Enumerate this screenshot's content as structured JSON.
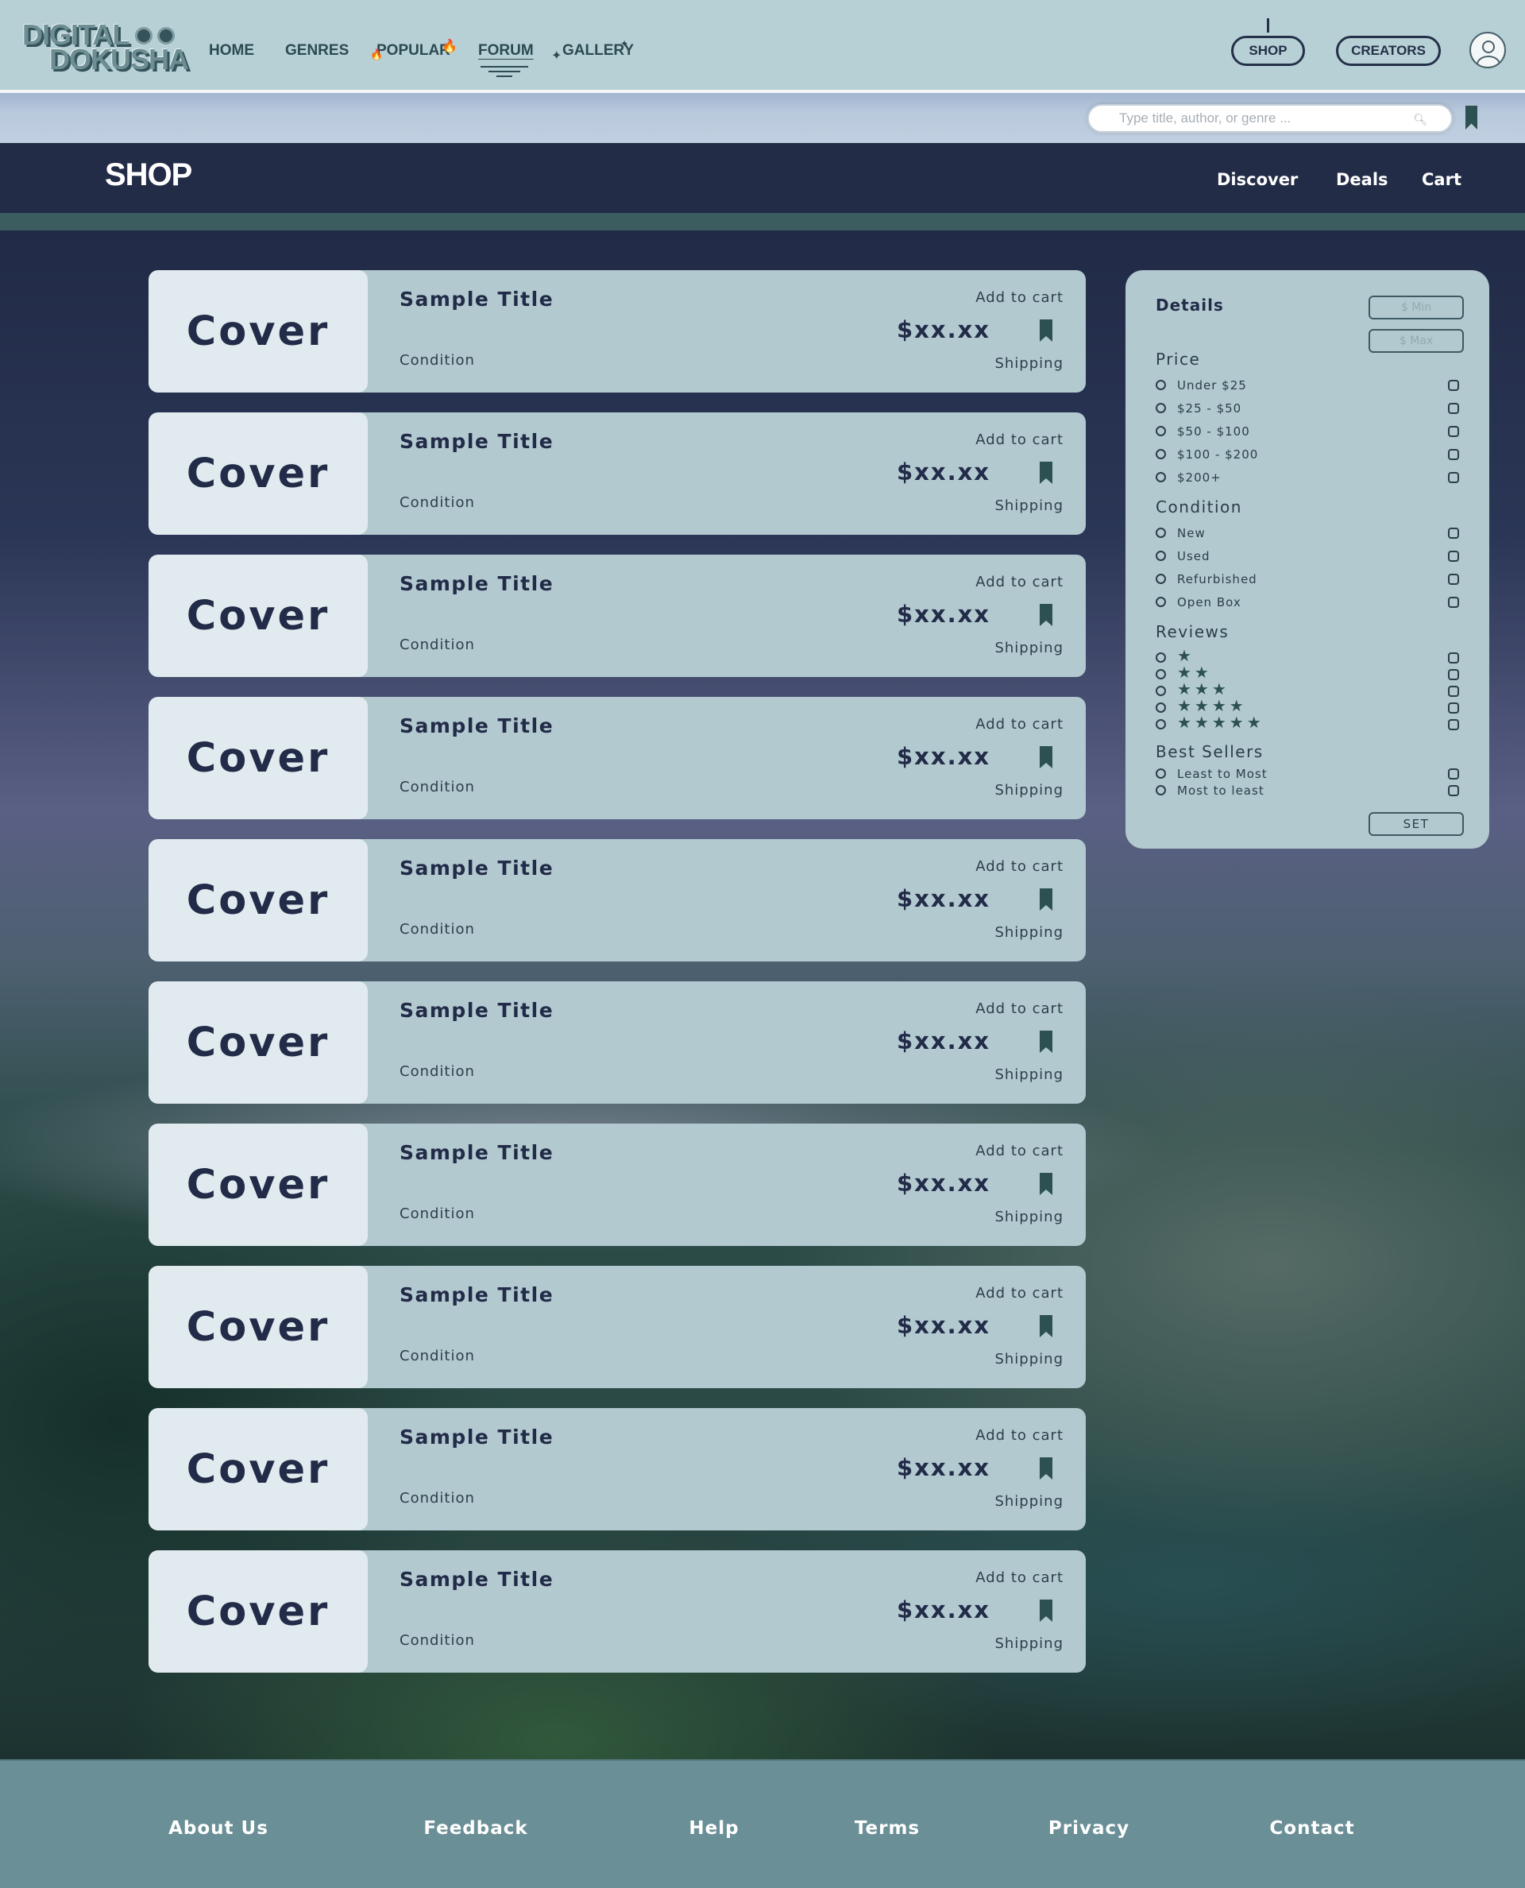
{
  "header": {
    "logo_line1": "DIGITAL",
    "logo_line2": "DOKUSHA",
    "nav": [
      "HOME",
      "GENRES",
      "POPULAR",
      "FORUM",
      "GALLERY"
    ],
    "shop_button": "SHOP",
    "creators_button": "CREATORS"
  },
  "search": {
    "placeholder": "Type title, author, or genre ..."
  },
  "shopbar": {
    "title": "SHOP",
    "nav": [
      "Discover",
      "Deals",
      "Cart"
    ]
  },
  "products": [
    {
      "cover": "Cover",
      "title": "Sample Title",
      "condition": "Condition",
      "add_to_cart": "Add to cart",
      "price": "$xx.xx",
      "shipping": "Shipping"
    },
    {
      "cover": "Cover",
      "title": "Sample Title",
      "condition": "Condition",
      "add_to_cart": "Add to cart",
      "price": "$xx.xx",
      "shipping": "Shipping"
    },
    {
      "cover": "Cover",
      "title": "Sample Title",
      "condition": "Condition",
      "add_to_cart": "Add to cart",
      "price": "$xx.xx",
      "shipping": "Shipping"
    },
    {
      "cover": "Cover",
      "title": "Sample Title",
      "condition": "Condition",
      "add_to_cart": "Add to cart",
      "price": "$xx.xx",
      "shipping": "Shipping"
    },
    {
      "cover": "Cover",
      "title": "Sample Title",
      "condition": "Condition",
      "add_to_cart": "Add to cart",
      "price": "$xx.xx",
      "shipping": "Shipping"
    },
    {
      "cover": "Cover",
      "title": "Sample Title",
      "condition": "Condition",
      "add_to_cart": "Add to cart",
      "price": "$xx.xx",
      "shipping": "Shipping"
    },
    {
      "cover": "Cover",
      "title": "Sample Title",
      "condition": "Condition",
      "add_to_cart": "Add to cart",
      "price": "$xx.xx",
      "shipping": "Shipping"
    },
    {
      "cover": "Cover",
      "title": "Sample Title",
      "condition": "Condition",
      "add_to_cart": "Add to cart",
      "price": "$xx.xx",
      "shipping": "Shipping"
    },
    {
      "cover": "Cover",
      "title": "Sample Title",
      "condition": "Condition",
      "add_to_cart": "Add to cart",
      "price": "$xx.xx",
      "shipping": "Shipping"
    },
    {
      "cover": "Cover",
      "title": "Sample Title",
      "condition": "Condition",
      "add_to_cart": "Add to cart",
      "price": "$xx.xx",
      "shipping": "Shipping"
    }
  ],
  "filters": {
    "title": "Details",
    "min_placeholder": "$ Min",
    "max_placeholder": "$ Max",
    "price_heading": "Price",
    "price_options": [
      "Under $25",
      "$25 - $50",
      "$50 - $100",
      "$100 - $200",
      "$200+"
    ],
    "condition_heading": "Condition",
    "condition_options": [
      "New",
      "Used",
      "Refurbished",
      "Open Box"
    ],
    "reviews_heading": "Reviews",
    "review_stars": [
      1,
      2,
      3,
      4,
      5
    ],
    "best_sellers_heading": "Best Sellers",
    "best_sellers_options": [
      "Least to Most",
      "Most to least"
    ],
    "set_button": "SET"
  },
  "footer": {
    "links": [
      "About Us",
      "Feedback",
      "Help",
      "Terms",
      "Privacy",
      "Contact"
    ]
  },
  "colors": {
    "navy": "#222b47",
    "teal": "#2d5152",
    "panel": "#b2c9d0",
    "header": "#b7d0d5",
    "footer": "#6a8f96"
  },
  "icons": {
    "bookmark": "bookmark-icon",
    "search": "search-icon",
    "user": "user-avatar-icon",
    "star": "star-icon"
  }
}
